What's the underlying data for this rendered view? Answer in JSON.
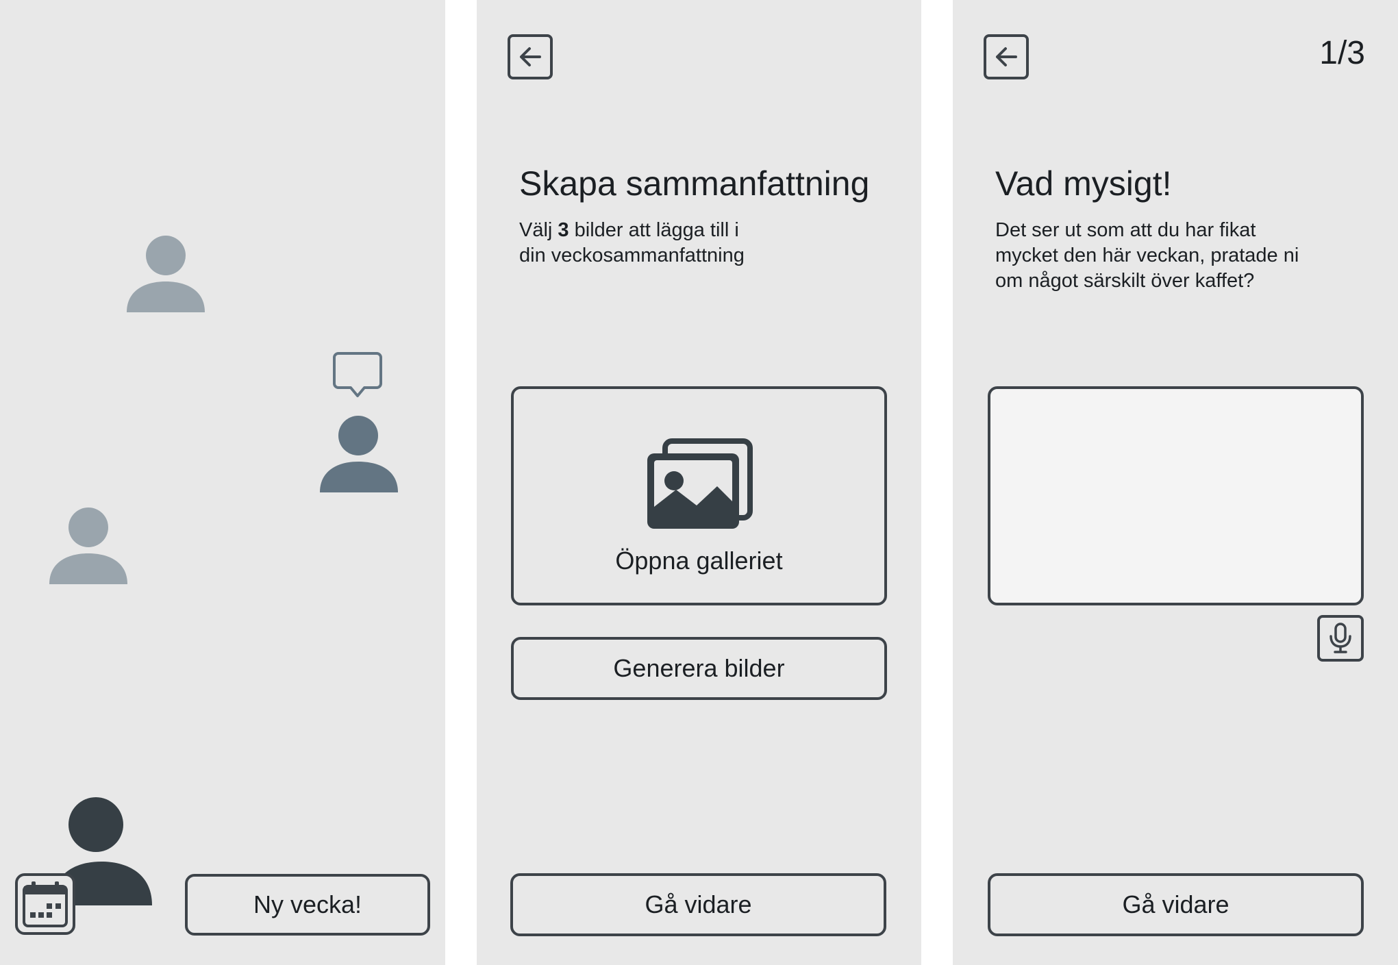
{
  "screen1": {
    "icons": [
      "person-icon",
      "speech-bubble-icon",
      "calendar-icon"
    ],
    "new_week_button": "Ny vecka!"
  },
  "screen2": {
    "title": "Skapa sammanfattning",
    "subtitle_pre": "Välj ",
    "subtitle_count": "3",
    "subtitle_post": " bilder att lägga till i\ndin veckosammanfattning",
    "gallery_button": "Öppna galleriet",
    "generate_button": "Generera bilder",
    "continue_button": "Gå vidare"
  },
  "screen3": {
    "counter": "1/3",
    "title": "Vad mysigt!",
    "body": "Det ser ut som att du har fikat\nmycket den här veckan, pratade ni\nom något särskilt över kaffet?",
    "answer_value": "",
    "continue_button": "Gå vidare"
  },
  "colors": {
    "panel_bg": "#e8e8e8",
    "border": "#3d4349",
    "person_light": "#9aa5ad",
    "person_mid": "#637583",
    "person_dark": "#363f45",
    "textarea_bg": "#f4f4f4"
  }
}
